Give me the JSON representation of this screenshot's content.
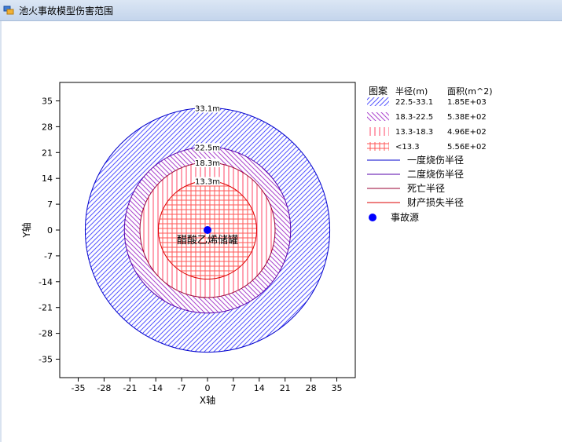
{
  "window": {
    "title": "池火事故模型伤害范围",
    "icon": "app-window-icon"
  },
  "chart_data": {
    "type": "scatter",
    "xlabel": "X轴",
    "ylabel": "Y轴",
    "xlim": [
      -40,
      40
    ],
    "ylim": [
      -40,
      40
    ],
    "xticks": [
      -35,
      -28,
      -21,
      -14,
      -7,
      0,
      7,
      14,
      21,
      28,
      35
    ],
    "yticks": [
      35,
      28,
      21,
      14,
      7,
      0,
      -7,
      -14,
      -21,
      -28,
      -35
    ],
    "xtick_labels": [
      "-35",
      "-28",
      "-21",
      "-14",
      "-7",
      "0",
      "7",
      "14",
      "21",
      "28",
      "35"
    ],
    "ytick_labels": [
      "35",
      "28",
      "21",
      "14",
      "7",
      "0",
      "-7",
      "-14",
      "-21",
      "-28",
      "-35"
    ],
    "grid": false,
    "legend_position": "right",
    "circles": [
      {
        "name": "一度烧伤半径",
        "radius": 33.1,
        "label": "33.1m",
        "color": "#0000cc",
        "fill": "#5555ff",
        "pattern": "fwd-diag"
      },
      {
        "name": "二度烧伤半径",
        "radius": 22.5,
        "label": "22.5m",
        "color": "#5500aa",
        "fill": "#aa44cc",
        "pattern": "back-diag"
      },
      {
        "name": "死亡半径",
        "radius": 18.3,
        "label": "18.3m",
        "color": "#990033",
        "fill": "#ff4466",
        "pattern": "vertical"
      },
      {
        "name": "财产损失半径",
        "radius": 13.3,
        "label": "13.3m",
        "color": "#dd0000",
        "fill": "#ff5555",
        "pattern": "grid"
      }
    ],
    "source": {
      "x": 0,
      "y": 0,
      "label": "醋酸乙烯储罐",
      "color": "#0000ff",
      "name": "事故源"
    }
  },
  "legend": {
    "header": {
      "pattern": "图案",
      "radius": "半径(m)",
      "area": "面积(m^2)"
    },
    "area_rows": [
      {
        "range": "22.5-33.1",
        "area": "1.85E+03",
        "pattern": "fwd-diag",
        "color": "#5555ff"
      },
      {
        "range": "18.3-22.5",
        "area": "5.38E+02",
        "pattern": "back-diag",
        "color": "#aa44cc"
      },
      {
        "range": "13.3-18.3",
        "area": "4.96E+02",
        "pattern": "vertical",
        "color": "#ff4466"
      },
      {
        "range": "<13.3",
        "area": "5.56E+02",
        "pattern": "grid",
        "color": "#ff3333"
      }
    ],
    "line_rows": [
      {
        "label": "一度烧伤半径",
        "color": "#0000cc"
      },
      {
        "label": "二度烧伤半径",
        "color": "#5500aa"
      },
      {
        "label": "死亡半径",
        "color": "#990033"
      },
      {
        "label": "财产损失半径",
        "color": "#dd0000"
      }
    ],
    "point_row": {
      "label": "事故源",
      "color": "#0000ff"
    }
  }
}
